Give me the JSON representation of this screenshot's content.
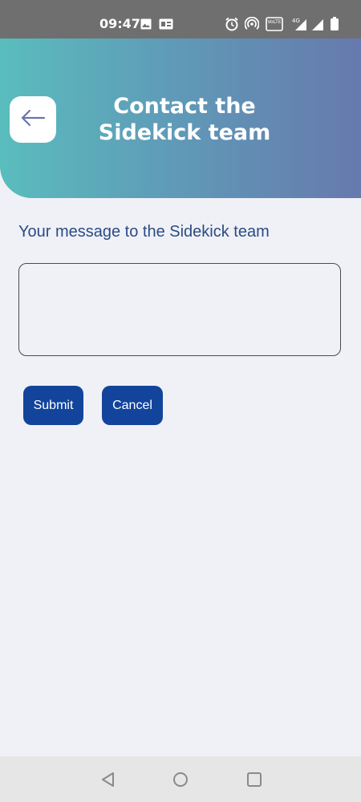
{
  "status_bar": {
    "time": "09:47",
    "volte_label": "Vo LTE",
    "network_label": "4G",
    "icons": [
      "image-icon",
      "gallery-icon",
      "alarm-icon",
      "hotspot-icon",
      "volte-icon",
      "signal-icon",
      "signal-icon",
      "battery-icon"
    ]
  },
  "header": {
    "title_line1": "Contact the",
    "title_line2": "Sidekick team",
    "back_icon": "arrow-left-icon"
  },
  "form": {
    "label": "Your message to the Sidekick team",
    "message_value": "",
    "submit_label": "Submit",
    "cancel_label": "Cancel"
  },
  "nav_bar": {
    "icons": [
      "back-triangle-icon",
      "home-circle-icon",
      "recents-square-icon"
    ]
  },
  "colors": {
    "header_gradient_start": "#59bdbd",
    "header_gradient_end": "#6779ad",
    "primary_button": "#13449c",
    "label_text": "#2a4b86",
    "background": "#f0f1f6"
  }
}
